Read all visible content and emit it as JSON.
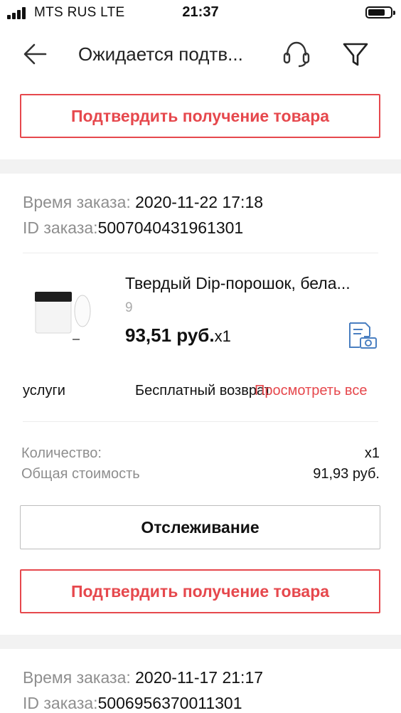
{
  "status_bar": {
    "carrier": "MTS RUS  LTE",
    "time": "21:37"
  },
  "nav": {
    "title": "Ожидается подтв...",
    "back_icon": "arrow-left-icon",
    "support_icon": "headset-icon",
    "filter_icon": "funnel-icon"
  },
  "top_button": {
    "label": "Подтвердить получение товара"
  },
  "order1": {
    "time_label": "Время заказа:",
    "time_value": "2020-11-22 17:18",
    "id_label": "ID заказа:",
    "id_value": "5007040431961301",
    "product": {
      "title": "Твердый Dip-порошок, бела...",
      "variant": "9",
      "price": "93,51 руб.",
      "qty": "x1",
      "image_icon": "powder-jar-image",
      "action_icon": "camera-document-icon"
    },
    "services": {
      "label": "услуги",
      "value": "Бесплатный возврат",
      "link": "Просмотреть все"
    },
    "quantity": {
      "label": "Количество:",
      "value": "x1"
    },
    "total": {
      "label": "Общая стоимость",
      "value": "91,93 руб."
    },
    "track_button": "Отслеживание",
    "confirm_button": "Подтвердить получение товара"
  },
  "order2": {
    "time_label": "Время заказа:",
    "time_value": "2020-11-17 21:17",
    "id_label": "ID заказа:",
    "id_value": "5006956370011301"
  },
  "colors": {
    "accent": "#e6484d",
    "muted": "#8e8e8e",
    "separator": "#f2f2f2",
    "link_blue": "#4a7fc1"
  }
}
